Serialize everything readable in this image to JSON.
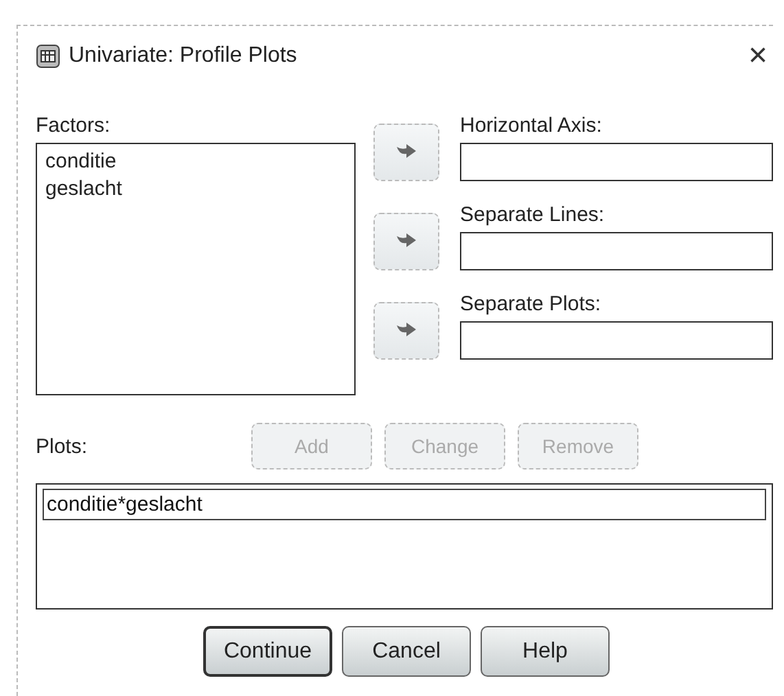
{
  "window": {
    "title": "Univariate: Profile Plots",
    "close": "×"
  },
  "factors": {
    "label": "Factors:",
    "items": [
      {
        "label": "conditie",
        "selected": false
      },
      {
        "label": "geslacht",
        "selected": false
      }
    ]
  },
  "targets": [
    {
      "label": "Horizontal Axis:"
    },
    {
      "label": "Separate Lines:"
    },
    {
      "label": "Separate Plots:"
    }
  ],
  "plots": {
    "label": "Plots:",
    "buttons": [
      {
        "label": "Add",
        "disabled": true
      },
      {
        "label": "Change",
        "disabled": true
      },
      {
        "label": "Remove",
        "disabled": true
      }
    ],
    "items": [
      {
        "label": "conditie*geslacht",
        "selected": true
      }
    ]
  },
  "buttons": [
    {
      "label": "Continue",
      "default": true
    },
    {
      "label": "Cancel",
      "default": false
    },
    {
      "label": "Help",
      "default": false
    }
  ]
}
